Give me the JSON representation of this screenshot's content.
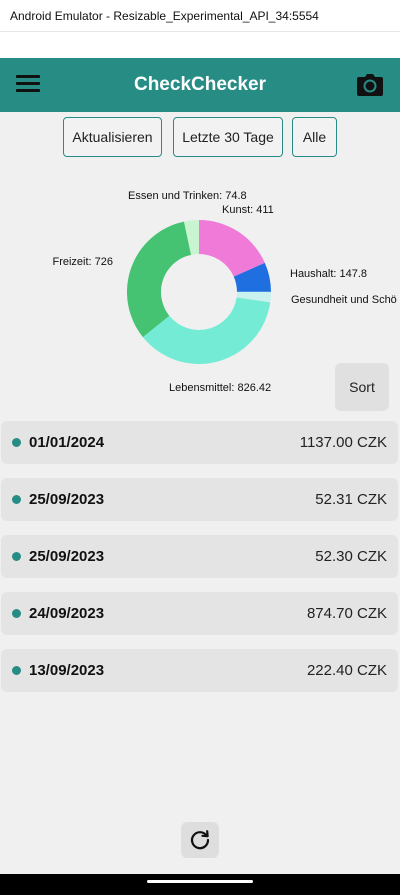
{
  "window": {
    "title": "Android Emulator - Resizable_Experimental_API_34:5554"
  },
  "app_bar": {
    "title": "CheckChecker",
    "menu_icon": "menu-icon",
    "camera_icon": "camera-icon"
  },
  "filters": {
    "refresh_label": "Aktualisieren",
    "last30_label": "Letzte 30 Tage",
    "all_label": "Alle"
  },
  "chart_data": {
    "type": "pie",
    "title": "",
    "donut": true,
    "slices": [
      {
        "label": "Kunst: 411",
        "category": "Kunst",
        "value": 411,
        "color": "#ef7ad8"
      },
      {
        "label": "Haushalt: 147.8",
        "category": "Haushalt",
        "value": 147.8,
        "color": "#1f6fe0"
      },
      {
        "label": "Gesundheit und Schö",
        "category": "Gesundheit und Schönheit",
        "value": 52.3,
        "color": "#c9f1ee"
      },
      {
        "label": "Lebensmittel: 826.42",
        "category": "Lebensmittel",
        "value": 826.42,
        "color": "#74ecd5"
      },
      {
        "label": "Freizeit: 726",
        "category": "Freizeit",
        "value": 726,
        "color": "#45c272"
      },
      {
        "label": "Essen und Trinken: 74.8",
        "category": "Essen und Trinken",
        "value": 74.8,
        "color": "#c8f4d0"
      }
    ]
  },
  "sort": {
    "label": "Sort"
  },
  "entries": [
    {
      "date": "01/01/2024",
      "amount": "1137.00 CZK"
    },
    {
      "date": "25/09/2023",
      "amount": "52.31 CZK"
    },
    {
      "date": "25/09/2023",
      "amount": "52.30 CZK"
    },
    {
      "date": "24/09/2023",
      "amount": "874.70 CZK"
    },
    {
      "date": "13/09/2023",
      "amount": "222.40 CZK"
    }
  ],
  "bottom": {
    "reload_icon": "reload-icon"
  },
  "colors": {
    "primary": "#268c84",
    "background": "#f0f0f0",
    "card": "#e4e4e4"
  }
}
